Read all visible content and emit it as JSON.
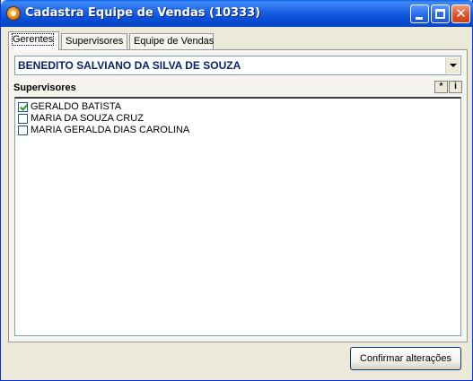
{
  "window": {
    "title": "Cadastra Equipe de Vendas (10333)"
  },
  "tabs": [
    {
      "label": "Gerentes",
      "active": true
    },
    {
      "label": "Supervisores",
      "active": false
    },
    {
      "label": "Equipe de Vendas",
      "active": false
    }
  ],
  "manager_combo": {
    "selected": "BENEDITO SALVIANO DA SILVA DE SOUZA"
  },
  "supervisors": {
    "label": "Supervisores",
    "buttons": {
      "asterisk": "*",
      "info": "i"
    },
    "items": [
      {
        "label": "GERALDO BATISTA",
        "checked": true
      },
      {
        "label": "MARIA DA SOUZA CRUZ",
        "checked": false
      },
      {
        "label": "MARIA GERALDA DIAS CAROLINA",
        "checked": false
      }
    ]
  },
  "footer": {
    "confirm_label": "Confirmar alterações"
  },
  "colors": {
    "titlebar": "#0a4fd6",
    "combo_text": "#0a246a",
    "check": "#21a121"
  }
}
